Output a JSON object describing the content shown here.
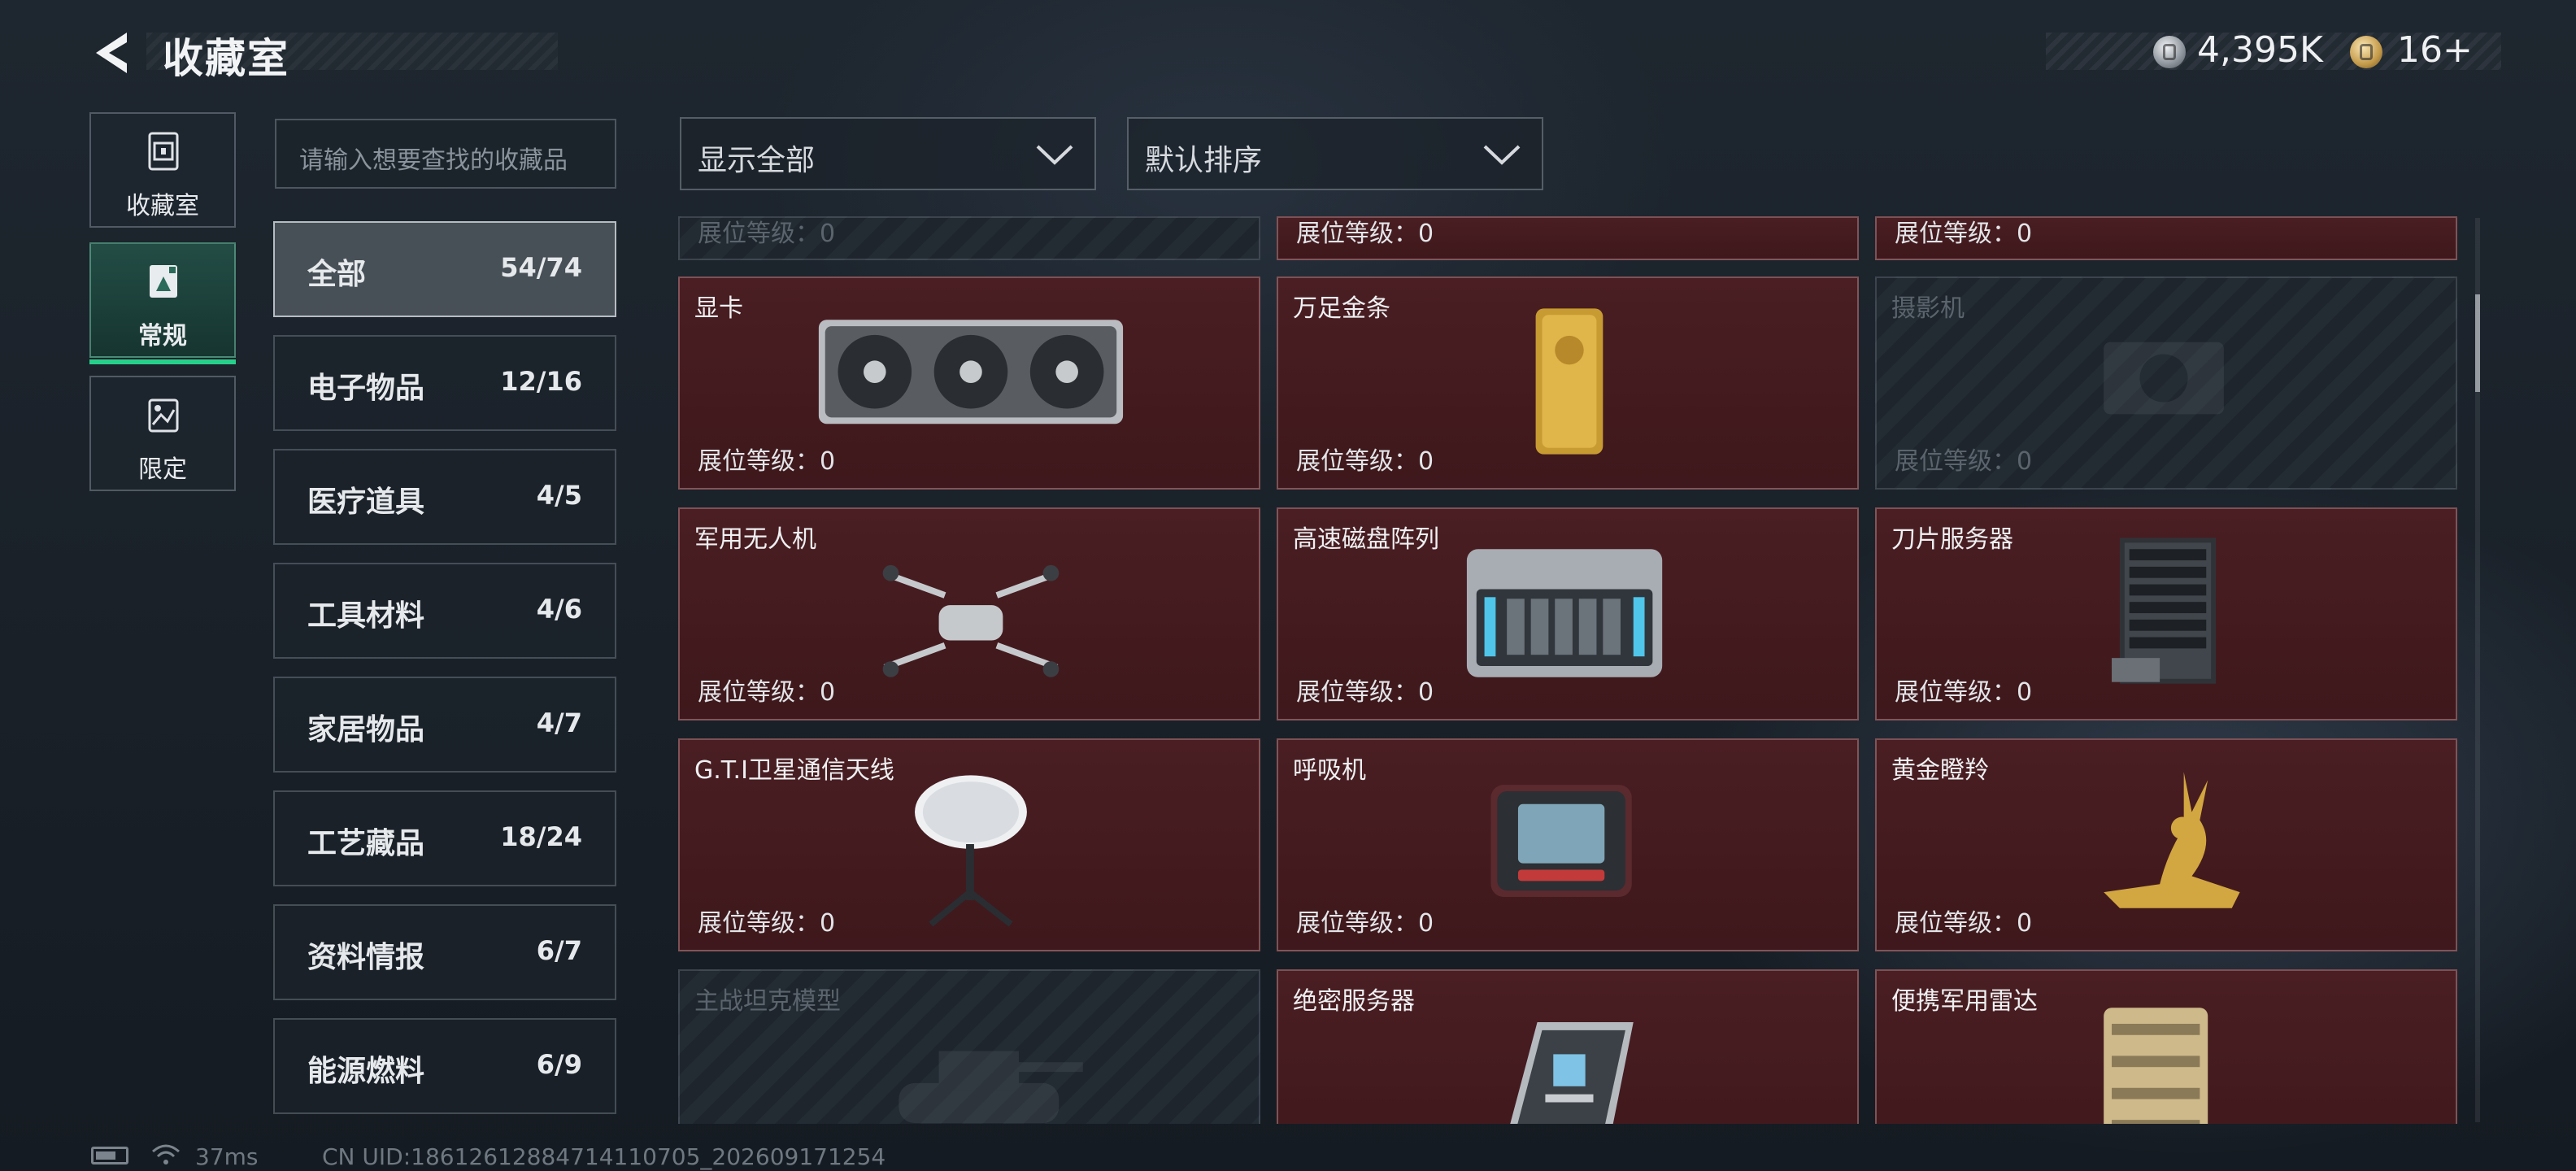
{
  "header": {
    "title": "收藏室",
    "currency_silver": "4,395K",
    "currency_gold": "16+"
  },
  "rail": [
    {
      "label": "收藏室",
      "icon": "vault-icon",
      "active": false
    },
    {
      "label": "常规",
      "icon": "item-box-icon",
      "active": true
    },
    {
      "label": "限定",
      "icon": "limited-icon",
      "active": false
    }
  ],
  "search": {
    "placeholder": "请输入想要查找的收藏品"
  },
  "categories": [
    {
      "name": "全部",
      "count": "54/74",
      "active": true
    },
    {
      "name": "电子物品",
      "count": "12/16"
    },
    {
      "name": "医疗道具",
      "count": "4/5"
    },
    {
      "name": "工具材料",
      "count": "4/6"
    },
    {
      "name": "家居物品",
      "count": "4/7"
    },
    {
      "name": "工艺藏品",
      "count": "18/24"
    },
    {
      "name": "资料情报",
      "count": "6/7"
    },
    {
      "name": "能源燃料",
      "count": "6/9"
    }
  ],
  "filters": {
    "display": "显示全部",
    "sort": "默认排序"
  },
  "level_label": "展位等级：0",
  "items": [
    {
      "name": "显卡",
      "owned": true,
      "icon": "graphics-card-icon"
    },
    {
      "name": "万足金条",
      "owned": true,
      "icon": "gold-bar-icon"
    },
    {
      "name": "摄影机",
      "owned": false,
      "icon": "camera-icon"
    },
    {
      "name": "军用无人机",
      "owned": true,
      "icon": "drone-icon"
    },
    {
      "name": "高速磁盘阵列",
      "owned": true,
      "icon": "disk-array-icon"
    },
    {
      "name": "刀片服务器",
      "owned": true,
      "icon": "blade-server-icon"
    },
    {
      "name": "G.T.I卫星通信天线",
      "owned": true,
      "icon": "satellite-dish-icon"
    },
    {
      "name": "呼吸机",
      "owned": true,
      "icon": "ventilator-icon"
    },
    {
      "name": "黄金瞪羚",
      "owned": true,
      "icon": "golden-gazelle-icon"
    },
    {
      "name": "主战坦克模型",
      "owned": false,
      "icon": "tank-model-icon"
    },
    {
      "name": "绝密服务器",
      "owned": true,
      "icon": "server-icon"
    },
    {
      "name": "便携军用雷达",
      "owned": true,
      "icon": "radar-icon"
    }
  ],
  "footer": {
    "ping": "37ms",
    "uid": "CN UID:18612612884714110705_202609171254"
  }
}
